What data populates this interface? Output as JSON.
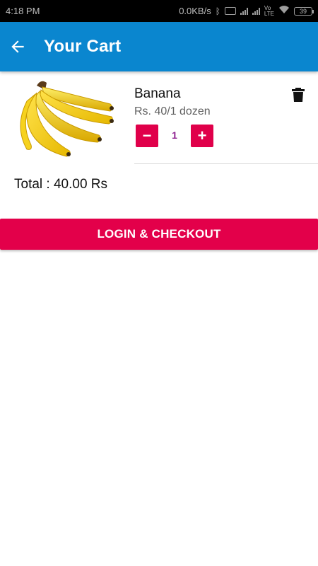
{
  "status_bar": {
    "time": "4:18 PM",
    "network_speed": "0.0KB/s",
    "battery_level": "39",
    "icons": [
      "bluetooth-icon",
      "vibrate-icon",
      "signal-icon",
      "signal-icon",
      "volte-icon",
      "wifi-icon",
      "battery-icon"
    ]
  },
  "app_bar": {
    "title": "Your Cart",
    "back_icon": "arrow-back-icon",
    "background_color": "#0a86cf"
  },
  "cart": {
    "items": [
      {
        "name": "Banana",
        "price": "Rs. 40/1 dozen",
        "quantity": "1",
        "image_icon": "banana-bunch-image",
        "decrement_label": "−",
        "increment_label": "+",
        "delete_icon": "trash-icon"
      }
    ],
    "total": "Total : 40.00 Rs"
  },
  "checkout": {
    "label": "LOGIN & CHECKOUT",
    "color": "#e3004a"
  },
  "colors": {
    "accent": "#e0004a",
    "quantity_text": "#8e1f8f"
  }
}
